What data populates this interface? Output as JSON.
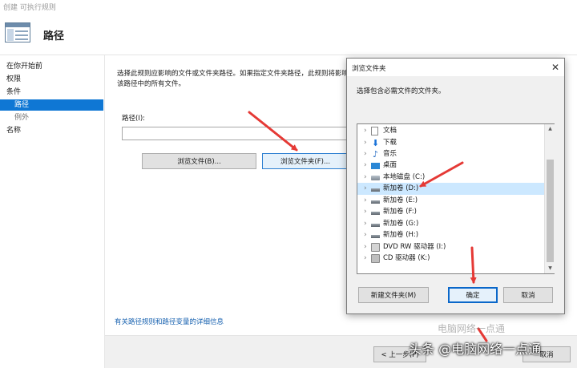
{
  "window": {
    "title": "创建 可执行规则"
  },
  "header": {
    "title": "路径"
  },
  "steps": [
    {
      "label": "在你开始前"
    },
    {
      "label": "权限"
    },
    {
      "label": "条件"
    },
    {
      "label": "路径"
    },
    {
      "label": "例外"
    },
    {
      "label": "名称"
    }
  ],
  "main": {
    "description": "选择此规则应影响的文件或文件夹路径。如果指定文件夹路径，此规则将影响该路径中的所有文件。",
    "path_label": "路径(I):",
    "path_value": "",
    "browse_file_label": "浏览文件(B)...",
    "browse_folder_label": "浏览文件夹(F)...",
    "info_link": "有关路径规则和路径变量的详细信息"
  },
  "footer": {
    "prev_label": "< 上一步(P)",
    "cancel_label": "取消"
  },
  "dialog": {
    "title": "浏览文件夹",
    "close_glyph": "✕",
    "prompt": "选择包含必需文件的文件夹。",
    "tree": [
      {
        "label": "文档",
        "icon": "document-icon"
      },
      {
        "label": "下载",
        "icon": "download-icon"
      },
      {
        "label": "音乐",
        "icon": "music-icon"
      },
      {
        "label": "桌面",
        "icon": "desktop-icon"
      },
      {
        "label": "本地磁盘 (C:)",
        "icon": "system-drive-icon"
      },
      {
        "label": "新加卷 (D:)",
        "icon": "drive-icon",
        "selected": true
      },
      {
        "label": "新加卷 (E:)",
        "icon": "drive-icon"
      },
      {
        "label": "新加卷 (F:)",
        "icon": "drive-icon"
      },
      {
        "label": "新加卷 (G:)",
        "icon": "drive-icon"
      },
      {
        "label": "新加卷 (H:)",
        "icon": "drive-icon"
      },
      {
        "label": "DVD RW 驱动器 (I:)",
        "icon": "dvd-drive-icon"
      },
      {
        "label": "CD 驱动器 (K:)",
        "icon": "cd-drive-icon"
      }
    ],
    "new_folder_label": "新建文件夹(M)",
    "ok_label": "确定",
    "cancel_label": "取消"
  },
  "watermark": {
    "text": "头条 @电脑网络一点通",
    "faint_text": "电脑网络一点通"
  },
  "colors": {
    "accent": "#0f77d4",
    "arrow": "#e53935",
    "selection": "#cce8ff"
  }
}
